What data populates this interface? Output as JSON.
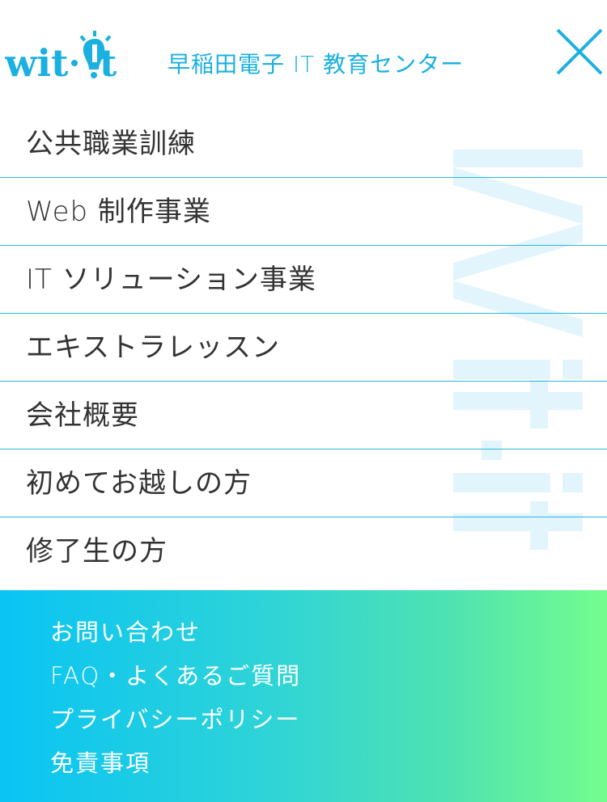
{
  "header": {
    "logo_text": "wit·it",
    "title": "早稲田電子 IT 教育センター",
    "close_icon": "close-icon"
  },
  "watermark_text": "wit·it",
  "menu": {
    "items": [
      {
        "label": "公共職業訓練"
      },
      {
        "label": "Web 制作事業"
      },
      {
        "label": "IT ソリューション事業"
      },
      {
        "label": "エキストラレッスン"
      },
      {
        "label": "会社概要"
      },
      {
        "label": "初めてお越しの方"
      },
      {
        "label": "修了生の方"
      }
    ]
  },
  "footer": {
    "links": [
      {
        "label": "お問い合わせ"
      },
      {
        "label": "FAQ・よくあるご質問"
      },
      {
        "label": "プライバシーポリシー"
      },
      {
        "label": "免責事項"
      }
    ]
  },
  "colors": {
    "accent": "#1ab0e0",
    "divider": "#29b6e6",
    "gradient_start": "#0ac4f4",
    "gradient_end": "#74fd8e",
    "watermark": "#e6f6fc"
  }
}
